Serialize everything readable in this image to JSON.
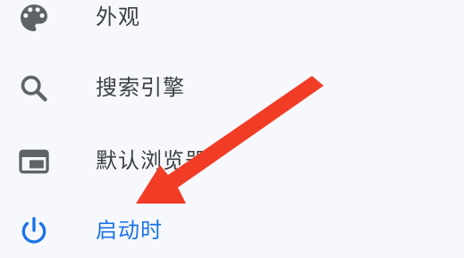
{
  "menu": {
    "items": [
      {
        "label": "外观",
        "icon": "palette-icon",
        "active": false
      },
      {
        "label": "搜索引擎",
        "icon": "search-icon",
        "active": false
      },
      {
        "label": "默认浏览器",
        "icon": "browser-window-icon",
        "active": false
      },
      {
        "label": "启动时",
        "icon": "power-icon",
        "active": true
      }
    ]
  },
  "colors": {
    "background": "#f7f8fc",
    "text": "#3c4043",
    "icon": "#5f6368",
    "active": "#1a73e8",
    "annotation_arrow": "#f13c26"
  }
}
